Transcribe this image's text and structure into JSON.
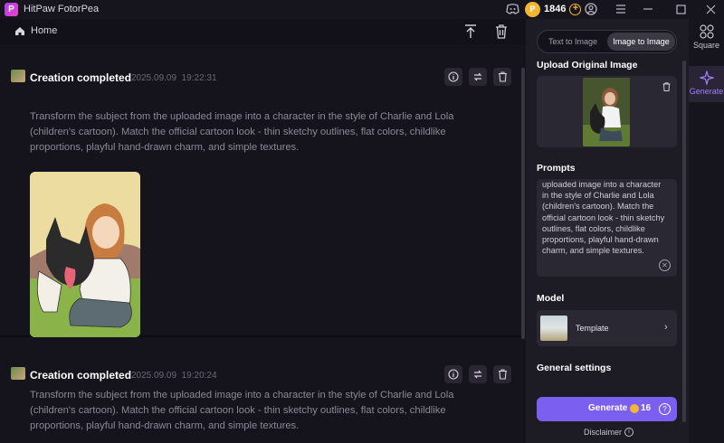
{
  "app": {
    "title": "HitPaw FotorPea",
    "logo": "P"
  },
  "titlebar": {
    "coins": "1846",
    "add": "+"
  },
  "topbar": {
    "home": "Home"
  },
  "cards": [
    {
      "title": "Creation completed",
      "date": "2025.09.09",
      "time": "19:22:31",
      "text": "Transform the subject from the uploaded image into a character in the style of Charlie and Lola (children's cartoon). Match the official cartoon look - thin sketchy outlines, flat colors, childlike proportions, playful hand-drawn charm, and simple textures."
    },
    {
      "title": "Creation completed",
      "date": "2025.09.09",
      "time": "19:20:24",
      "text": "Transform the subject from the uploaded image into a character in the style of Charlie and Lola (children's cartoon). Match the official cartoon look - thin sketchy outlines, flat colors, childlike proportions, playful hand-drawn charm, and simple textures."
    }
  ],
  "panel": {
    "tabs": [
      "Text to Image",
      "Image to Image"
    ],
    "upload_title": "Upload Original Image",
    "prompts_title": "Prompts",
    "prompt_text": "uploaded image into a character in the style of Charlie and Lola (children's cartoon). Match the official cartoon look - thin sketchy outlines, flat colors, childlike proportions, playful hand-drawn charm, and simple textures.",
    "model_title": "Model",
    "model_name": "Template",
    "general_title": "General settings",
    "generate_label": "Generate",
    "generate_cost": "16",
    "disclaimer": "Disclaimer"
  },
  "sidenav": {
    "items": [
      "Square",
      "Generate"
    ]
  },
  "colors": {
    "accent": "#7b5ff0",
    "coin": "#f1b733"
  }
}
